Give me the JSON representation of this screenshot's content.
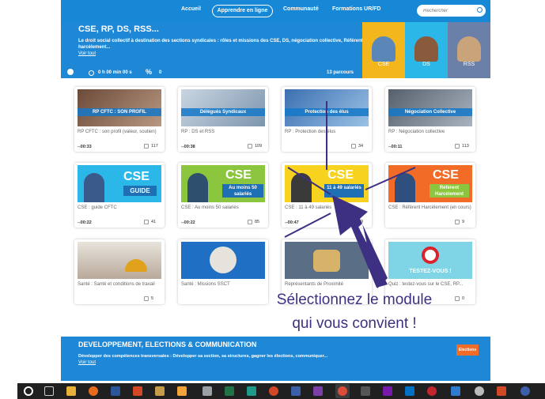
{
  "nav": {
    "accueil": "Accueil",
    "apprendre": "Apprendre en ligne",
    "communaute": "Communauté",
    "formations": "Formations UR/FD",
    "search_placeholder": "Rechercher"
  },
  "banner": {
    "title": "CSE, RP, DS, RSS...",
    "description": "Le droit social collectif à destination des sections syndicales : rôles et missions des CSE, DS, négociation collective, Référent harcèlement...",
    "link": "Voir tout",
    "time": "0 h 00 min 00 s",
    "percent_symbol": "%",
    "percent": "0",
    "parcours": "13 parcours",
    "roles": [
      "CSE",
      "DS",
      "RSS"
    ]
  },
  "cards": [
    {
      "thumb_label": "RP CFTC : SON PROFIL",
      "title": "RP CFTC : son profil (valeur, soutien)",
      "duration": "--00:33",
      "likes": "117"
    },
    {
      "thumb_label": "Délégués Syndicaux",
      "title": "RP : DS et RSS",
      "duration": "--00:38",
      "likes": "109"
    },
    {
      "thumb_label": "Protection des élus",
      "title": "RP : Protection des élus",
      "duration": "",
      "likes": "34"
    },
    {
      "thumb_label": "Négociation Collective",
      "title": "RP : Négociation collective",
      "duration": "--00:11",
      "likes": "113"
    },
    {
      "thumb_label": "GUIDE",
      "title": "CSE : guide CFTC",
      "duration": "--00:22",
      "likes": "41"
    },
    {
      "thumb_label": "Au moins 50 salariés",
      "title": "CSE : Au moins 50 salariés",
      "duration": "--00:22",
      "likes": "85"
    },
    {
      "thumb_label": "11 à 49 salariés",
      "title": "CSE : 11 à 49 salariés",
      "duration": "--00:47",
      "likes": "49"
    },
    {
      "thumb_label": "Référent Harcèlement",
      "title": "CSE : Référent Harcèlement (en cours)",
      "duration": "",
      "likes": "9"
    },
    {
      "thumb_label": "",
      "title": "Santé : Santé et conditions de travail",
      "duration": "",
      "likes": "5"
    },
    {
      "thumb_label": "",
      "title": "Santé : Missions SSCT",
      "duration": "",
      "likes": ""
    },
    {
      "thumb_label": "",
      "title": "Représentants de Proximité",
      "duration": "",
      "likes": ""
    },
    {
      "thumb_label": "TESTEZ-VOUS !",
      "title": "Quiz : testez-vous sur le CSE, RP...",
      "duration": "",
      "likes": "0"
    }
  ],
  "cse_badge": "CSE",
  "banner2": {
    "title": "DEVELOPPEMENT, ELECTIONS & COMMUNICATION",
    "description": "Développer des compétences transversales : Développer sa section, sa structures, gagner les élections, communiquer...",
    "link": "Voir tout",
    "sign": "Elections"
  },
  "overlay": {
    "line1": "Sélectionnez le module",
    "line2": "qui vous convient !"
  },
  "colors": {
    "brand": "#1688d6",
    "cse_panel": "#f3b61c",
    "ds_panel": "#2bb8e8",
    "rss_panel": "#6a80a8",
    "arrow": "#3d2f82"
  }
}
